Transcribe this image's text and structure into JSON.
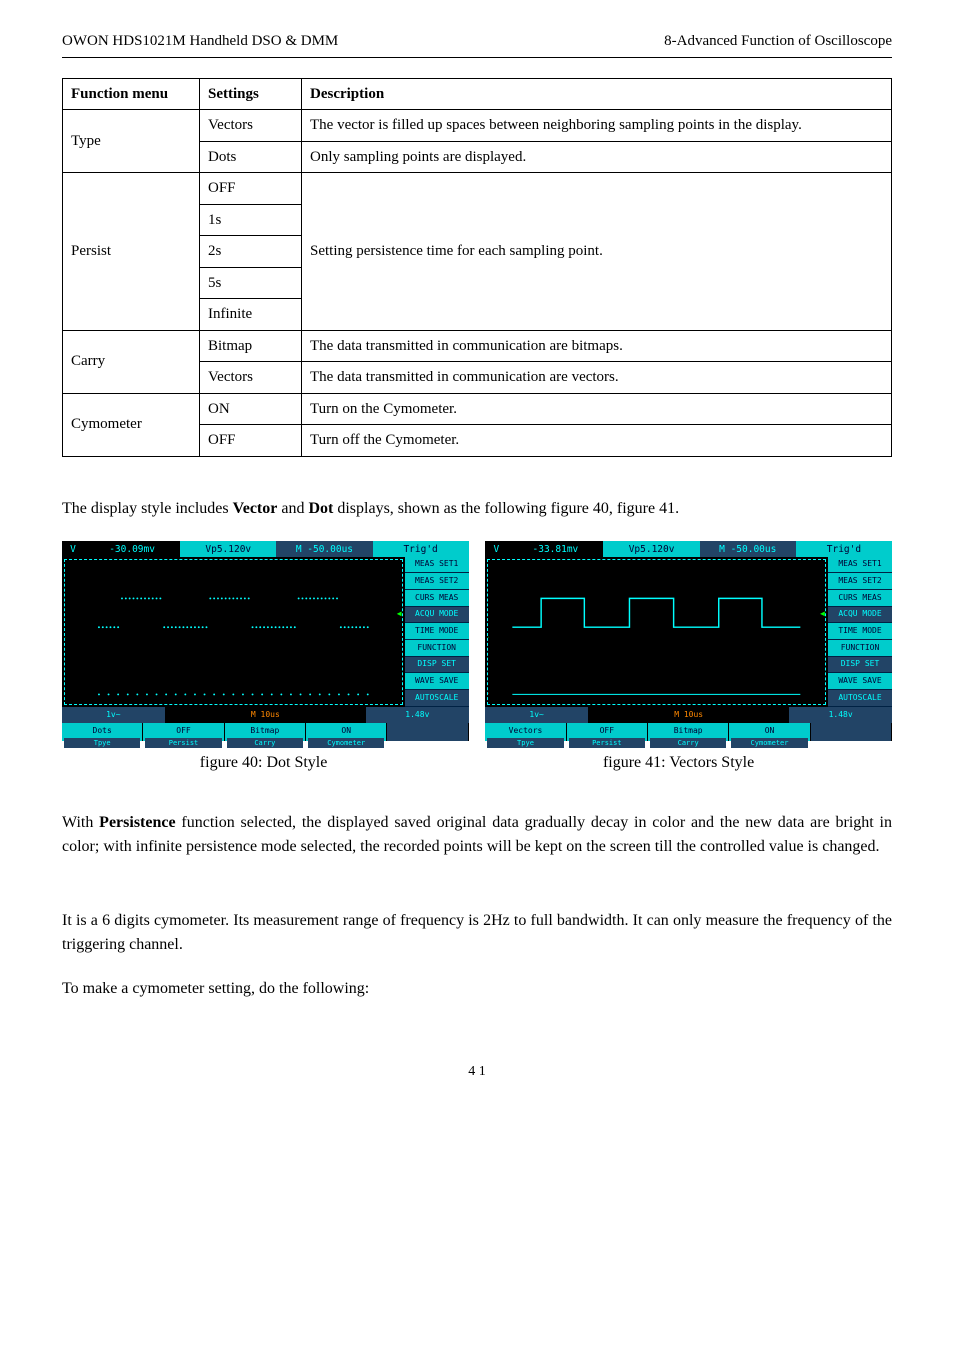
{
  "header": {
    "left": "OWON    HDS1021M Handheld DSO & DMM",
    "right": "8-Advanced Function of Oscilloscope"
  },
  "table": {
    "headers": [
      "Function menu",
      "Settings",
      "Description"
    ],
    "rows": [
      {
        "fn": "Type",
        "settings": [
          "Vectors",
          "Dots"
        ],
        "desc": [
          "The vector is filled up spaces between neighboring sampling points in the display.",
          "Only sampling points are displayed."
        ]
      },
      {
        "fn": "Persist",
        "settings": [
          "OFF",
          "1s",
          "2s",
          "5s",
          "Infinite"
        ],
        "desc": "Setting persistence time for each sampling point."
      },
      {
        "fn": "Carry",
        "settings": [
          "Bitmap",
          "Vectors"
        ],
        "desc": [
          "The data transmitted in communication are bitmaps.",
          "The data transmitted in communication are vectors."
        ]
      },
      {
        "fn": "Cymometer",
        "settings": [
          "ON",
          "OFF"
        ],
        "desc": [
          "Turn on the Cymometer.",
          "Turn off the Cymometer."
        ]
      }
    ]
  },
  "para1": "The display style includes Vector and Dot displays, shown as the following figure 40, figure 41.",
  "screen_left": {
    "top": {
      "v": "V",
      "mv": "-30.09mv",
      "vp": "Vp5.120v",
      "m": "M -50.00us",
      "trig": "Trig'd"
    },
    "side": [
      "MEAS SET1",
      "MEAS SET2",
      "CURS MEAS",
      "ACQU MODE",
      "TIME MODE",
      "FUNCTION",
      "DISP SET",
      "WAVE SAVE",
      "AUTOSCALE"
    ],
    "bot1": {
      "l": "1v~",
      "m": "M 10us",
      "r": "1.48v"
    },
    "bot2": [
      {
        "t": "Dots",
        "s": "Tpye"
      },
      {
        "t": "OFF",
        "s": "Persist"
      },
      {
        "t": "Bitmap",
        "s": "Carry"
      },
      {
        "t": "ON",
        "s": "Cymometer"
      },
      {
        "t": "",
        "s": ""
      }
    ]
  },
  "screen_right": {
    "top": {
      "v": "V",
      "mv": "-33.81mv",
      "vp": "Vp5.120v",
      "m": "M -50.00us",
      "trig": "Trig'd"
    },
    "side": [
      "MEAS SET1",
      "MEAS SET2",
      "CURS MEAS",
      "ACQU MODE",
      "TIME MODE",
      "FUNCTION",
      "DISP SET",
      "WAVE SAVE",
      "AUTOSCALE"
    ],
    "bot1": {
      "l": "1v~",
      "m": "M 10us",
      "r": "1.48v"
    },
    "bot2": [
      {
        "t": "Vectors",
        "s": "Tpye"
      },
      {
        "t": "OFF",
        "s": "Persist"
      },
      {
        "t": "Bitmap",
        "s": "Carry"
      },
      {
        "t": "ON",
        "s": "Cymometer"
      },
      {
        "t": "",
        "s": ""
      }
    ]
  },
  "caption_left": "figure 40: Dot Style",
  "caption_right": "figure 41: Vectors Style",
  "para2": "With Persistence function selected, the displayed saved original data gradually decay in color and the new data are bright in color; with infinite persistence mode selected, the recorded points will be kept on the screen till the controlled value is changed.",
  "para3": "It is a 6 digits cymometer. Its measurement range of frequency is 2Hz to full bandwidth. It can only measure the frequency of the triggering channel.",
  "para4": "To make a cymometer setting, do the following:",
  "footer": "4 1"
}
